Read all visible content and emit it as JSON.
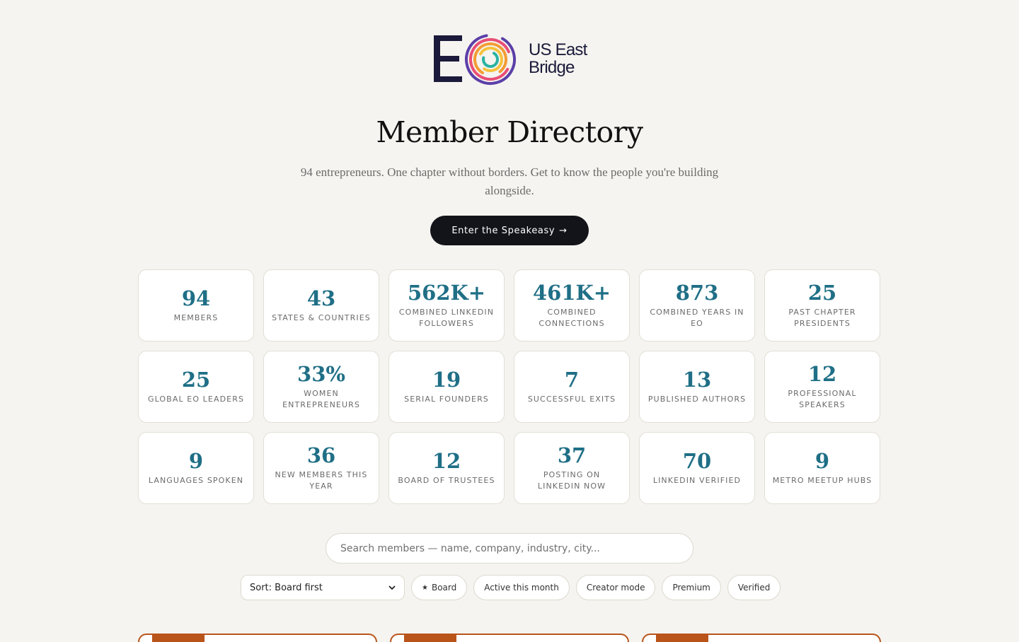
{
  "brand": {
    "logo_letter": "E",
    "line1": "US East",
    "line2": "Bridge",
    "ring_colors": [
      "#5b3fa8",
      "#e94e77",
      "#f39c34",
      "#f6c23e",
      "#2bb3a3"
    ],
    "ink_color": "#1b1a3a"
  },
  "page": {
    "title": "Member Directory",
    "subtitle": "94 entrepreneurs. One chapter without borders. Get to know the people you're building alongside.",
    "cta_label": "Enter the Speakeasy",
    "cta_arrow": "→"
  },
  "stats": [
    {
      "value": "94",
      "label": "Members"
    },
    {
      "value": "43",
      "label": "States & Countries"
    },
    {
      "value": "562K+",
      "label": "Combined LinkedIn Followers"
    },
    {
      "value": "461K+",
      "label": "Combined Connections"
    },
    {
      "value": "873",
      "label": "Combined Years in EO"
    },
    {
      "value": "25",
      "label": "Past Chapter Presidents"
    },
    {
      "value": "25",
      "label": "Global EO Leaders"
    },
    {
      "value": "33%",
      "label": "Women Entrepreneurs"
    },
    {
      "value": "19",
      "label": "Serial Founders"
    },
    {
      "value": "7",
      "label": "Successful Exits"
    },
    {
      "value": "13",
      "label": "Published Authors"
    },
    {
      "value": "12",
      "label": "Professional Speakers"
    },
    {
      "value": "9",
      "label": "Languages Spoken"
    },
    {
      "value": "36",
      "label": "New Members This Year"
    },
    {
      "value": "12",
      "label": "Board of Trustees"
    },
    {
      "value": "37",
      "label": "Posting on LinkedIn Now"
    },
    {
      "value": "70",
      "label": "LinkedIn Verified"
    },
    {
      "value": "9",
      "label": "Metro Meetup Hubs"
    }
  ],
  "search": {
    "placeholder": "Search members — name, company, industry, city..."
  },
  "filters": {
    "sort_value": "Sort: Board first",
    "chips": [
      {
        "label": "Board",
        "icon": "star-icon",
        "glyph": "★"
      },
      {
        "label": "Active this month"
      },
      {
        "label": "Creator mode"
      },
      {
        "label": "Premium"
      },
      {
        "label": "Verified"
      }
    ]
  },
  "colors": {
    "accent": "#1f6f86",
    "card_accent": "#b9541a",
    "cta_bg": "#121419",
    "background": "#f5f4f0"
  }
}
